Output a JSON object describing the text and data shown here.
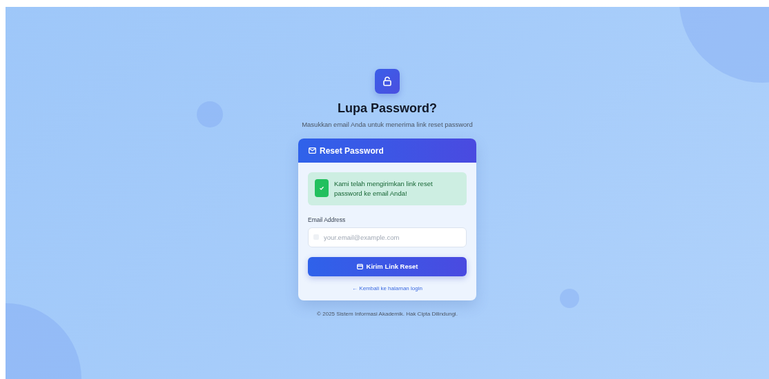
{
  "title": "Lupa Password?",
  "subtitle": "Masukkan email Anda untuk menerima link reset password",
  "card": {
    "title": "Reset Password",
    "alert": {
      "kind": "success",
      "message": "Kami telah mengirimkan link reset password ke email Anda!"
    },
    "email": {
      "label": "Email Address",
      "placeholder": "your.email@example.com"
    },
    "submit": "Kirim Link Reset",
    "back_link": "← Kembali ke halaman login"
  },
  "footer": "© 2025 Sistem Informasi Akademik. Hak Cipta Dilindungi."
}
